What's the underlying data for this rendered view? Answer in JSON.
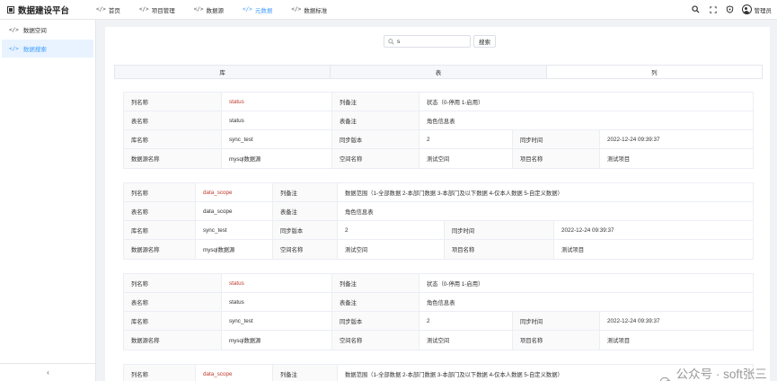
{
  "app": {
    "title": "数据建设平台",
    "user": "管理员"
  },
  "nav": [
    {
      "label": "首页",
      "active": false
    },
    {
      "label": "项目管理",
      "active": false
    },
    {
      "label": "数据源",
      "active": false
    },
    {
      "label": "元数据",
      "active": true
    },
    {
      "label": "数据标准",
      "active": false
    }
  ],
  "sidebar": {
    "items": [
      {
        "label": "数据空间",
        "active": false
      },
      {
        "label": "数据搜索",
        "active": true
      }
    ]
  },
  "search": {
    "value": "s",
    "button": "搜索"
  },
  "tabs": [
    {
      "label": "库",
      "active": false
    },
    {
      "label": "表",
      "active": false
    },
    {
      "label": "列",
      "active": true
    }
  ],
  "labels": {
    "column_name": "列名称",
    "column_comment": "列备注",
    "table_name": "表名称",
    "table_comment": "表备注",
    "db_name": "库名称",
    "sync_version": "同步版本",
    "sync_time": "同步时间",
    "datasource_name": "数据源名称",
    "space_name": "空间名称",
    "project_name": "项目名称"
  },
  "results": [
    {
      "column": "status",
      "column_comment": "状态（0-停用 1-启用）",
      "table": "status",
      "table_comment": "角色信息表",
      "db": "sync_test",
      "version": "2",
      "time": "2022-12-24 09:39:37",
      "datasource": "mysql数据源",
      "space": "测试空间",
      "project": "测试项目"
    },
    {
      "column": "data_scope",
      "column_comment": "数据范围（1-全部数据 2-本部门数据 3-本部门及以下数据 4-仅本人数据 5-自定义数据）",
      "table": "data_scope",
      "table_comment": "角色信息表",
      "db": "sync_test",
      "version": "2",
      "time": "2022-12-24 09:39:37",
      "datasource": "mysql数据源",
      "space": "测试空间",
      "project": "测试项目"
    },
    {
      "column": "status",
      "column_comment": "状态（0-停用 1-启用）",
      "table": "status",
      "table_comment": "角色信息表",
      "db": "sync_test",
      "version": "2",
      "time": "2022-12-24 09:39:37",
      "datasource": "mysql数据源",
      "space": "测试空间",
      "project": "测试项目"
    },
    {
      "column": "data_scope",
      "column_comment": "数据范围（1-全部数据 2-本部门数据 3-本部门及以下数据 4-仅本人数据 5-自定义数据）",
      "table": "",
      "table_comment": "",
      "db": "",
      "version": "",
      "time": "",
      "datasource": "",
      "space": "",
      "project": ""
    }
  ],
  "watermark": "公众号 · soft张三丰"
}
